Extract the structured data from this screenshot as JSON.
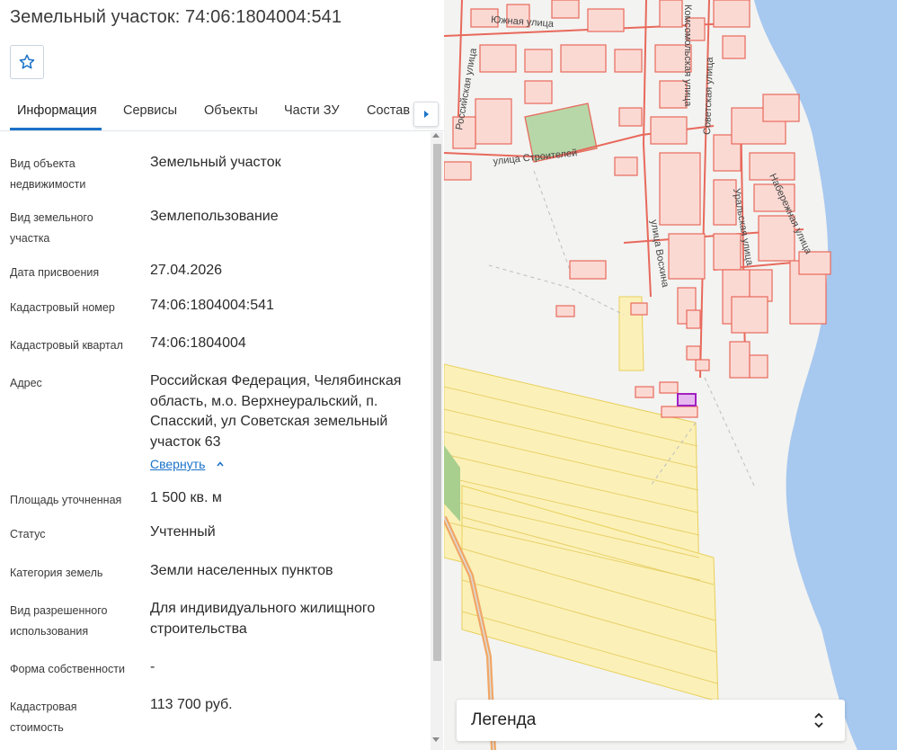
{
  "header": {
    "title": "Земельный участок: 74:06:1804004:541"
  },
  "tabs": [
    {
      "label": "Информация",
      "active": true
    },
    {
      "label": "Сервисы"
    },
    {
      "label": "Объекты"
    },
    {
      "label": "Части ЗУ"
    },
    {
      "label": "Состав"
    }
  ],
  "info": {
    "rows": [
      {
        "label": "Вид объекта недвижимости",
        "value": "Земельный участок"
      },
      {
        "label": "Вид земельного участка",
        "value": "Землепользование"
      },
      {
        "label": "Дата присвоения",
        "value": "27.04.2026"
      },
      {
        "label": "Кадастровый номер",
        "value": "74:06:1804004:541"
      },
      {
        "label": "Кадастровый квартал",
        "value": "74:06:1804004"
      },
      {
        "label": "Адрес",
        "value": "Российская Федерация, Челябинская область, м.о. Верхнеуральский, п. Спасский, ул Советская земельный участок 63"
      },
      {
        "label": "Площадь уточненная",
        "value": "1 500 кв. м"
      },
      {
        "label": "Статус",
        "value": "Учтенный"
      },
      {
        "label": "Категория земель",
        "value": "Земли населенных пунктов"
      },
      {
        "label": "Вид разрешенного использования",
        "value": "Для индивидуального жилищного строительства"
      },
      {
        "label": "Форма собственности",
        "value": "-"
      },
      {
        "label": "Кадастровая стоимость",
        "value": "113 700 руб."
      }
    ],
    "collapse_link": "Свернуть"
  },
  "map": {
    "streets": [
      "Южная улица",
      "Российская улица",
      "улица Строителей",
      "Советская улица",
      "Уральская улица",
      "улица Восхина",
      "Набережная улица",
      "Комсомольская улица"
    ],
    "colors": {
      "water": "#a7c8ef",
      "parcel": "#e8695c",
      "field": "#fbf1b8",
      "selected": "#a020c0"
    }
  },
  "legend": {
    "label": "Легенда"
  }
}
